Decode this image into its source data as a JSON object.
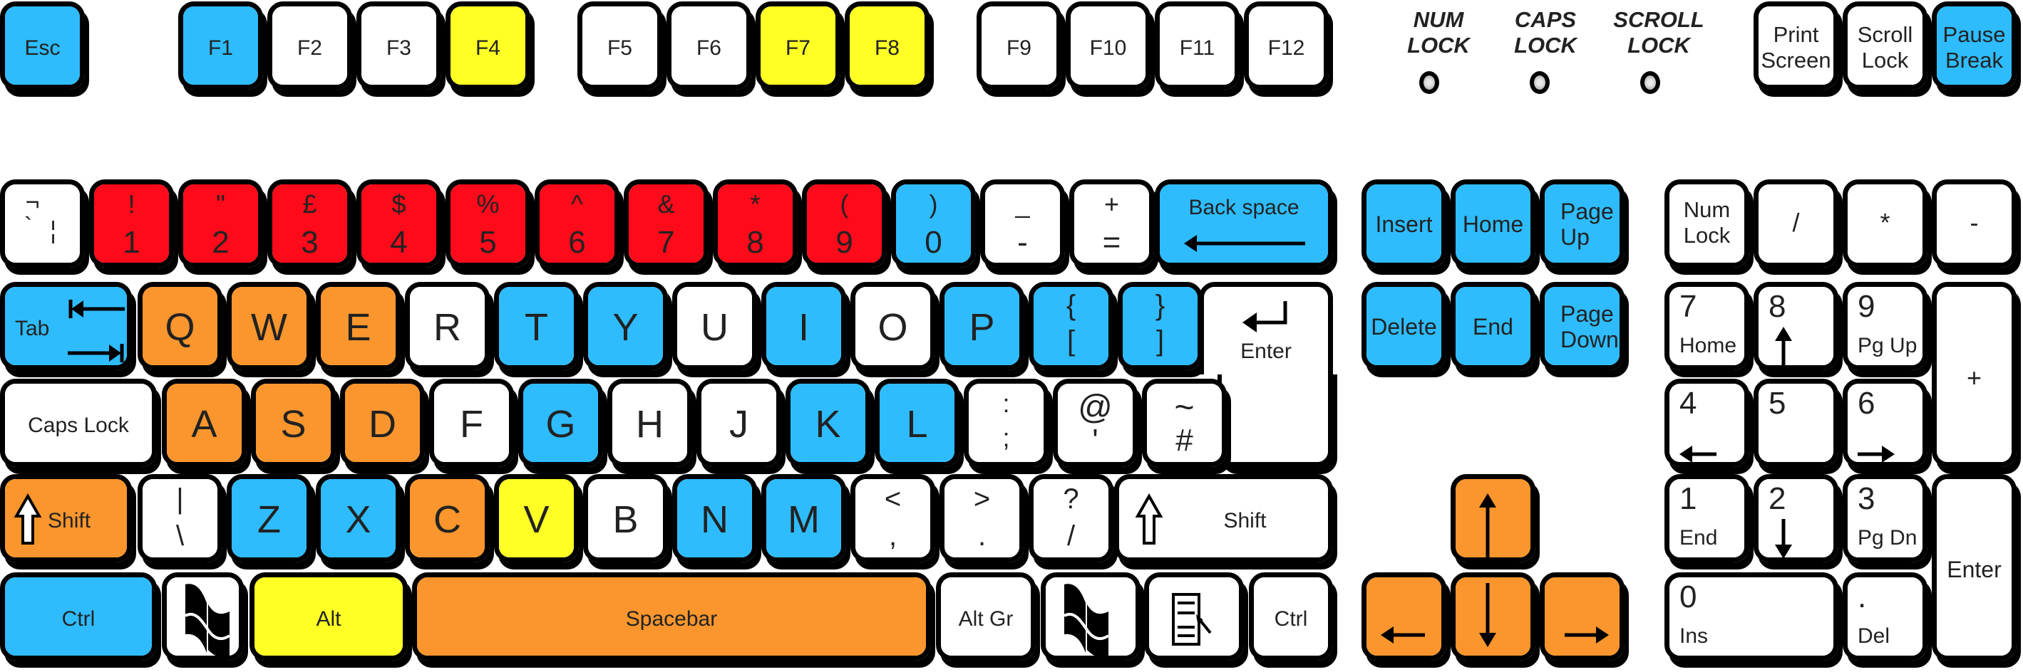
{
  "colors": {
    "white": "#ffffff",
    "blue": "#2ebcff",
    "orange": "#fa962d",
    "red": "#ff0a1a",
    "yellow": "#ffff26",
    "outline": "#000000"
  },
  "indicators": [
    {
      "id": "num-lock",
      "label_top": "NUM",
      "label_bottom": "LOCK"
    },
    {
      "id": "caps-lock",
      "label_top": "CAPS",
      "label_bottom": "LOCK"
    },
    {
      "id": "scroll-lock",
      "label_top": "SCROLL",
      "label_bottom": "LOCK"
    }
  ],
  "rows": {
    "function": [
      {
        "id": "esc",
        "label": "Esc",
        "color": "blue"
      },
      {
        "id": "f1",
        "label": "F1",
        "color": "blue"
      },
      {
        "id": "f2",
        "label": "F2",
        "color": "white"
      },
      {
        "id": "f3",
        "label": "F3",
        "color": "white"
      },
      {
        "id": "f4",
        "label": "F4",
        "color": "yellow"
      },
      {
        "id": "f5",
        "label": "F5",
        "color": "white"
      },
      {
        "id": "f6",
        "label": "F6",
        "color": "white"
      },
      {
        "id": "f7",
        "label": "F7",
        "color": "yellow"
      },
      {
        "id": "f8",
        "label": "F8",
        "color": "yellow"
      },
      {
        "id": "f9",
        "label": "F9",
        "color": "white"
      },
      {
        "id": "f10",
        "label": "F10",
        "color": "white"
      },
      {
        "id": "f11",
        "label": "F11",
        "color": "white"
      },
      {
        "id": "f12",
        "label": "F12",
        "color": "white"
      },
      {
        "id": "print-screen",
        "label": "Print",
        "label2": "Screen",
        "color": "white"
      },
      {
        "id": "scroll-lock",
        "label": "Scroll",
        "label2": "Lock",
        "color": "white"
      },
      {
        "id": "pause-break",
        "label": "Pause",
        "label2": "Break",
        "color": "blue"
      }
    ],
    "number": [
      {
        "id": "backtick",
        "top": "¬",
        "bottom": "`",
        "extra": "¦",
        "color": "white"
      },
      {
        "id": "1",
        "top": "!",
        "bottom": "1",
        "color": "red"
      },
      {
        "id": "2",
        "top": "\"",
        "bottom": "2",
        "color": "red"
      },
      {
        "id": "3",
        "top": "£",
        "bottom": "3",
        "color": "red"
      },
      {
        "id": "4",
        "top": "$",
        "bottom": "4",
        "color": "red"
      },
      {
        "id": "5",
        "top": "%",
        "bottom": "5",
        "color": "red"
      },
      {
        "id": "6",
        "top": "^",
        "bottom": "6",
        "color": "red"
      },
      {
        "id": "7",
        "top": "&",
        "bottom": "7",
        "color": "red"
      },
      {
        "id": "8",
        "top": "*",
        "bottom": "8",
        "color": "red"
      },
      {
        "id": "9",
        "top": "(",
        "bottom": "9",
        "color": "red"
      },
      {
        "id": "0",
        "top": ")",
        "bottom": "0",
        "color": "blue"
      },
      {
        "id": "minus",
        "top": "_",
        "bottom": "-",
        "color": "white"
      },
      {
        "id": "equals",
        "top": "+",
        "bottom": "=",
        "color": "white"
      },
      {
        "id": "backspace",
        "label": "Back space",
        "icon": "backspace-arrow-icon",
        "color": "blue"
      }
    ],
    "qwerty": [
      {
        "id": "tab",
        "label": "Tab",
        "icon": "tab-arrows-icon",
        "color": "blue"
      },
      {
        "id": "q",
        "label": "Q",
        "color": "orange"
      },
      {
        "id": "w",
        "label": "W",
        "color": "orange"
      },
      {
        "id": "e",
        "label": "E",
        "color": "orange"
      },
      {
        "id": "r",
        "label": "R",
        "color": "white"
      },
      {
        "id": "t",
        "label": "T",
        "color": "blue"
      },
      {
        "id": "y",
        "label": "Y",
        "color": "blue"
      },
      {
        "id": "u",
        "label": "U",
        "color": "white"
      },
      {
        "id": "i",
        "label": "I",
        "color": "blue"
      },
      {
        "id": "o",
        "label": "O",
        "color": "white"
      },
      {
        "id": "p",
        "label": "P",
        "color": "blue"
      },
      {
        "id": "bracket-left",
        "top": "{",
        "bottom": "[",
        "color": "blue"
      },
      {
        "id": "bracket-right",
        "top": "}",
        "bottom": "]",
        "color": "blue"
      },
      {
        "id": "enter",
        "label": "Enter",
        "icon": "enter-arrow-icon",
        "color": "white"
      }
    ],
    "home": [
      {
        "id": "caps-lock",
        "label": "Caps Lock",
        "color": "white"
      },
      {
        "id": "a",
        "label": "A",
        "color": "orange"
      },
      {
        "id": "s",
        "label": "S",
        "color": "orange"
      },
      {
        "id": "d",
        "label": "D",
        "color": "orange"
      },
      {
        "id": "f",
        "label": "F",
        "color": "white"
      },
      {
        "id": "g",
        "label": "G",
        "color": "blue"
      },
      {
        "id": "h",
        "label": "H",
        "color": "white"
      },
      {
        "id": "j",
        "label": "J",
        "color": "white"
      },
      {
        "id": "k",
        "label": "K",
        "color": "blue"
      },
      {
        "id": "l",
        "label": "L",
        "color": "blue"
      },
      {
        "id": "semicolon",
        "top": ":",
        "bottom": ";",
        "color": "white"
      },
      {
        "id": "quote",
        "top": "@",
        "bottom": "'",
        "color": "white"
      },
      {
        "id": "hash",
        "top": "~",
        "bottom": "#",
        "color": "white"
      }
    ],
    "shift": [
      {
        "id": "shift-left",
        "label": "Shift",
        "icon": "shift-arrow-icon",
        "color": "orange"
      },
      {
        "id": "backslash",
        "top": "|",
        "bottom": "\\",
        "color": "white"
      },
      {
        "id": "z",
        "label": "Z",
        "color": "blue"
      },
      {
        "id": "x",
        "label": "X",
        "color": "blue"
      },
      {
        "id": "c",
        "label": "C",
        "color": "orange"
      },
      {
        "id": "v",
        "label": "V",
        "color": "yellow"
      },
      {
        "id": "b",
        "label": "B",
        "color": "white"
      },
      {
        "id": "n",
        "label": "N",
        "color": "blue"
      },
      {
        "id": "m",
        "label": "M",
        "color": "blue"
      },
      {
        "id": "comma",
        "top": "<",
        "bottom": ",",
        "color": "white"
      },
      {
        "id": "period",
        "top": ">",
        "bottom": ".",
        "color": "white"
      },
      {
        "id": "slash",
        "top": "?",
        "bottom": "/",
        "color": "white"
      },
      {
        "id": "shift-right",
        "label": "Shift",
        "icon": "shift-arrow-icon",
        "color": "white"
      }
    ],
    "bottom": [
      {
        "id": "ctrl-left",
        "label": "Ctrl",
        "color": "blue"
      },
      {
        "id": "win-left",
        "label": "",
        "icon": "windows-logo-icon",
        "color": "white"
      },
      {
        "id": "alt",
        "label": "Alt",
        "color": "yellow"
      },
      {
        "id": "spacebar",
        "label": "Spacebar",
        "color": "orange"
      },
      {
        "id": "alt-gr",
        "label": "Alt Gr",
        "color": "white"
      },
      {
        "id": "win-right",
        "label": "",
        "icon": "windows-logo-icon",
        "color": "white"
      },
      {
        "id": "menu",
        "label": "",
        "icon": "context-menu-icon",
        "color": "white"
      },
      {
        "id": "ctrl-right",
        "label": "Ctrl",
        "color": "white"
      }
    ]
  },
  "navigation": [
    {
      "id": "insert",
      "label": "Insert",
      "color": "blue"
    },
    {
      "id": "home",
      "label": "Home",
      "color": "blue"
    },
    {
      "id": "page-up",
      "label": "Page",
      "label2": "Up",
      "color": "blue"
    },
    {
      "id": "delete",
      "label": "Delete",
      "color": "blue"
    },
    {
      "id": "end",
      "label": "End",
      "color": "blue"
    },
    {
      "id": "page-down",
      "label": "Page",
      "label2": "Down",
      "color": "blue"
    }
  ],
  "arrows": [
    {
      "id": "arrow-up",
      "icon": "arrow-up-icon",
      "color": "orange"
    },
    {
      "id": "arrow-left",
      "icon": "arrow-left-icon",
      "color": "orange"
    },
    {
      "id": "arrow-down",
      "icon": "arrow-down-icon",
      "color": "orange"
    },
    {
      "id": "arrow-right",
      "icon": "arrow-right-icon",
      "color": "orange"
    }
  ],
  "numpad": [
    {
      "id": "num-lock",
      "label": "Num",
      "label2": "Lock",
      "color": "white"
    },
    {
      "id": "num-divide",
      "label": "/",
      "color": "white"
    },
    {
      "id": "num-multiply",
      "label": "*",
      "color": "white"
    },
    {
      "id": "num-minus",
      "label": "-",
      "color": "white"
    },
    {
      "id": "num-7",
      "top": "7",
      "bottom": "Home",
      "color": "white"
    },
    {
      "id": "num-8",
      "top": "8",
      "icon": "arrow-up-icon",
      "color": "white"
    },
    {
      "id": "num-9",
      "top": "9",
      "bottom": "Pg Up",
      "color": "white"
    },
    {
      "id": "num-plus",
      "label": "+",
      "color": "white"
    },
    {
      "id": "num-4",
      "top": "4",
      "icon": "arrow-left-icon",
      "color": "white"
    },
    {
      "id": "num-5",
      "top": "5",
      "color": "white"
    },
    {
      "id": "num-6",
      "top": "6",
      "icon": "arrow-right-icon",
      "color": "white"
    },
    {
      "id": "num-1",
      "top": "1",
      "bottom": "End",
      "color": "white"
    },
    {
      "id": "num-2",
      "top": "2",
      "icon": "arrow-down-icon",
      "color": "white"
    },
    {
      "id": "num-3",
      "top": "3",
      "bottom": "Pg Dn",
      "color": "white"
    },
    {
      "id": "num-enter",
      "label": "Enter",
      "color": "white"
    },
    {
      "id": "num-0",
      "top": "0",
      "bottom": "Ins",
      "color": "white"
    },
    {
      "id": "num-decimal",
      "top": ".",
      "bottom": "Del",
      "color": "white"
    }
  ]
}
